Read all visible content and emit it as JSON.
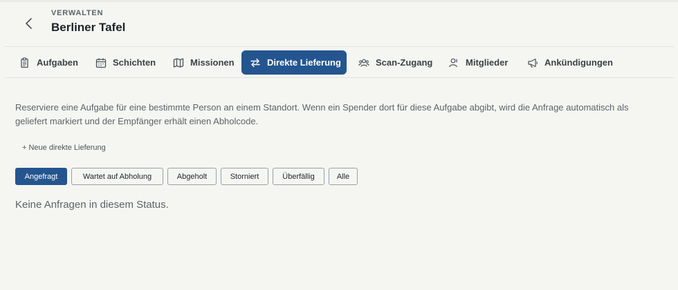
{
  "header": {
    "eyebrow": "VERWALTEN",
    "title": "Berliner Tafel"
  },
  "tabs": [
    {
      "label": "Aufgaben",
      "icon": "clipboard-icon",
      "active": false
    },
    {
      "label": "Schichten",
      "icon": "calendar-icon",
      "active": false
    },
    {
      "label": "Missionen",
      "icon": "map-icon",
      "active": false
    },
    {
      "label": "Direkte Lieferung",
      "icon": "arrows-exchange-icon",
      "active": true
    },
    {
      "label": "Scan-Zugang",
      "icon": "users-group-icon",
      "active": false
    },
    {
      "label": "Mitglieder",
      "icon": "user-icon",
      "active": false
    },
    {
      "label": "Ankündigungen",
      "icon": "megaphone-icon",
      "active": false
    }
  ],
  "description": "Reserviere eine Aufgabe für eine bestimmte Person an einem Standort. Wenn ein Spender dort für diese Aufgabe abgibt, wird die Anfrage automatisch als geliefert markiert und der Empfänger erhält einen Abholcode.",
  "new_delivery_label": "+ Neue direkte Lieferung",
  "filters": [
    {
      "label": "Angefragt",
      "active": true
    },
    {
      "label": "Wartet auf Abholung",
      "active": false
    },
    {
      "label": "Abgeholt",
      "active": false
    },
    {
      "label": "Storniert",
      "active": false
    },
    {
      "label": "Überfällig",
      "active": false
    },
    {
      "label": "Alle",
      "active": false
    }
  ],
  "empty_message": "Keine Anfragen in diesem Status.",
  "colors": {
    "accent": "#24558f",
    "background": "#f5f6f2"
  }
}
